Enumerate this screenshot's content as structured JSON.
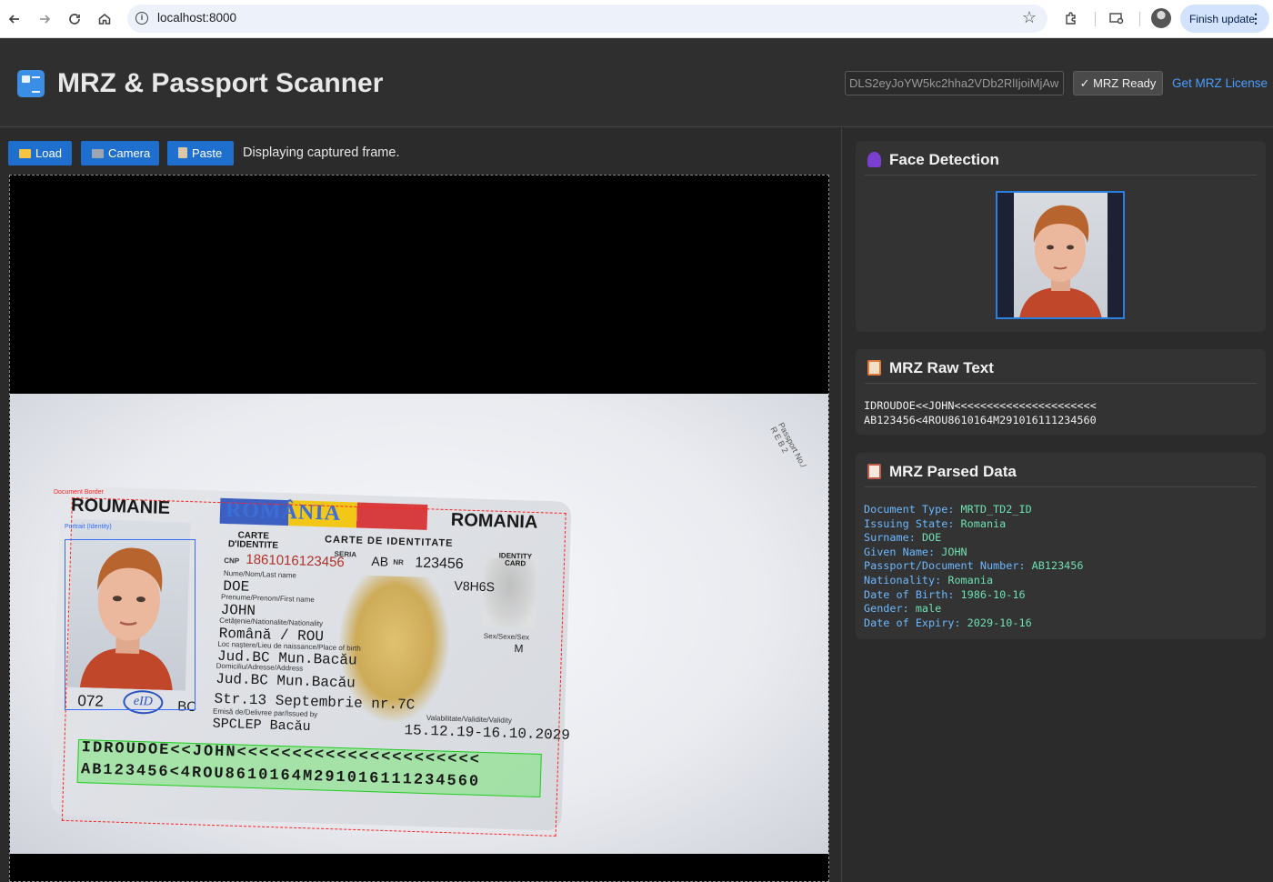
{
  "browser": {
    "url": "localhost:8000",
    "finish_update": "Finish update"
  },
  "header": {
    "title": "MRZ & Passport Scanner",
    "license_key": "DLS2eyJoYW5kc2hha2VDb2RlIjoiMjAwMI",
    "mrz_ready": "✓ MRZ Ready",
    "get_license": "Get MRZ License"
  },
  "toolbar": {
    "load_label": "Load",
    "camera_label": "Camera",
    "paste_label": "Paste",
    "status": "Displaying captured frame."
  },
  "card": {
    "roumanie": "ROUMANIE",
    "romania_band": "ROMÂNIA",
    "romania": "ROMANIA",
    "carte_didentite": "CARTE\nD'IDENTITE",
    "carte_de_identitate": "CARTE DE IDENTITATE",
    "identity_card": "IDENTITY\nCARD",
    "seria_label": "SERIA",
    "seria_value": "AB",
    "nr_label": "NR",
    "nr_value": "123456",
    "cnp_label": "CNP",
    "cnp_value": "1861016123456",
    "code": "V8H6S",
    "surname_label": "Nume/Nom/Last name",
    "surname": "DOE",
    "given_label": "Prenume/Prenom/First name",
    "given": "JOHN",
    "nationality_label": "Cetățenie/Nationalite/Nationality",
    "nationality": "Română / ROU",
    "sex_label": "Sex/Sexe/Sex",
    "sex": "M",
    "birthplace_label": "Loc naștere/Lieu de naissance/Place of birth",
    "birthplace": "Jud.BC Mun.Bacău",
    "address_label": "Domiciliu/Adresse/Address",
    "address_1": "Jud.BC Mun.Bacău",
    "address_2": "Str.13 Septembrie nr.7C",
    "issued_label": "Emisă de/Delivree par/Issued by",
    "issued_by": "SPCLEP Bacău",
    "validity_label": "Valabilitate/Validite/Validity",
    "validity": "15.12.19-16.10.2029",
    "code_072": "072",
    "code_bc": "BC",
    "mrz_line_1": "IDROUDOE<<JOHN<<<<<<<<<<<<<<<<<<<<<<",
    "mrz_line_2": "AB123456<4ROU8610164M291016111234560",
    "background_text": "Passport No./\nR E B 2"
  },
  "detection": {
    "document_border_label": "Document Border",
    "portrait_label": "Portrait (Identity)"
  },
  "face_panel": {
    "title": "Face Detection"
  },
  "raw_panel": {
    "title": "MRZ Raw Text",
    "line_1": "IDROUDOE<<JOHN<<<<<<<<<<<<<<<<<<<<<<",
    "line_2": "AB123456<4ROU8610164M291016111234560"
  },
  "parsed_panel": {
    "title": "MRZ Parsed Data",
    "fields": [
      {
        "key": "Document Type:",
        "value": "MRTD_TD2_ID"
      },
      {
        "key": "Issuing State:",
        "value": "Romania"
      },
      {
        "key": "Surname:",
        "value": "DOE"
      },
      {
        "key": "Given Name:",
        "value": "JOHN"
      },
      {
        "key": "Passport/Document Number:",
        "value": "AB123456"
      },
      {
        "key": "Nationality:",
        "value": "Romania"
      },
      {
        "key": "Date of Birth:",
        "value": "1986-10-16"
      },
      {
        "key": "Gender:",
        "value": "male"
      },
      {
        "key": "Date of Expiry:",
        "value": "2029-10-16"
      }
    ]
  },
  "colors": {
    "accent_blue": "#1f6fce",
    "link": "#4a9eff",
    "field_key": "#6cb8ff",
    "field_value": "#6ee0b2",
    "mrz_highlight": "#22cc22",
    "document_border": "#ff2020",
    "portrait_box": "#2f6cff"
  }
}
